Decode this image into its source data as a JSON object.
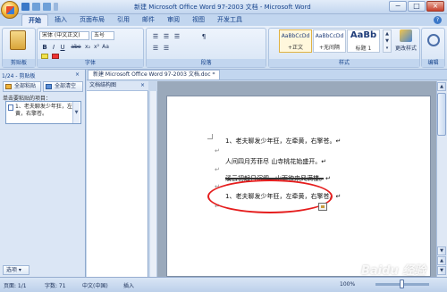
{
  "window": {
    "title": "新建 Microsoft Office Word 97-2003 文档 - Microsoft Word",
    "controls": [
      "−",
      "□",
      "×"
    ]
  },
  "ribbon": {
    "tabs": [
      "开始",
      "插入",
      "页面布局",
      "引用",
      "邮件",
      "审阅",
      "视图",
      "开发工具"
    ],
    "active_tab": "开始",
    "groups": [
      "剪贴板",
      "字体",
      "段落",
      "样式"
    ],
    "font_name": "宋体 (中文正文)",
    "font_size": "五号",
    "styles": [
      {
        "sample": "AaBbCcDd",
        "name": "+正文"
      },
      {
        "sample": "AaBbCcDd",
        "name": "+无间隔"
      },
      {
        "sample": "AaBb",
        "name": "标题 1"
      }
    ],
    "change_styles": "更改样式",
    "edit": "编辑",
    "font_buttons": [
      "B",
      "I",
      "U",
      "abe",
      "x₂",
      "x²",
      "Aa"
    ],
    "para_buttons": [
      "☰",
      "☰",
      "☰",
      "☰",
      "☰",
      "¶"
    ]
  },
  "clipboard_pane": {
    "header": "1/24 - 剪贴板",
    "paste_all": "全部粘贴",
    "clear_all": "全部清空",
    "hint": "单击要粘贴的项目：",
    "item_text": "1、老夫聊发少年狂，左牵黄，右擎苍。",
    "options": "选项"
  },
  "document_tab": "新建 Microsoft Office Word 97-2003 文档.doc *",
  "nav_pane_header": "文档结构图",
  "document": {
    "para1": "1、老夫聊发少年狂，左牵黄，右擎苍。↵",
    "para2": "人间四月芳菲尽 山寺桃花始盛开。↵",
    "para3": "溪云初起日沉阁，山雨欲来风满楼。↵",
    "para4": "1、老夫聊发少年狂，左牵黄，右擎苍。↵",
    "para_mark": "↵"
  },
  "statusbar": {
    "page": "页面: 1/1",
    "words": "字数: 71",
    "lang": "中文(中国)",
    "mode": "插入",
    "zoom": "100%"
  },
  "watermark": "Baidu 经验"
}
